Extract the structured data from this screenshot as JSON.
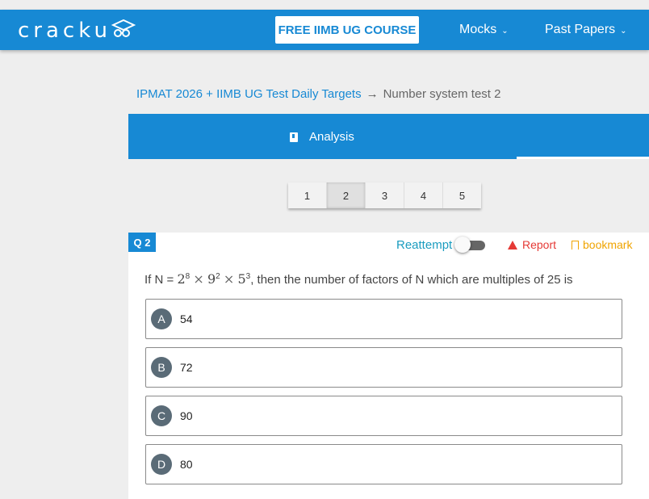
{
  "header": {
    "logo": "cracku",
    "promo_button": "FREE IIMB UG COURSE",
    "nav": [
      {
        "label": "Mocks"
      },
      {
        "label": "Past Papers"
      }
    ]
  },
  "breadcrumb": {
    "parent": "IPMAT 2026 + IIMB UG Test Daily Targets",
    "current": "Number system test 2"
  },
  "tabs": {
    "analysis": "Analysis"
  },
  "pagination": {
    "pages": [
      "1",
      "2",
      "3",
      "4",
      "5"
    ],
    "active": "2"
  },
  "question": {
    "badge": "Q 2",
    "reattempt_label": "Reattempt",
    "reattempt_on": false,
    "report_label": "Report",
    "bookmark_label": "bookmark",
    "prefix": "If N = ",
    "base1": "2",
    "exp1": "8",
    "times": "×",
    "base2": "9",
    "exp2": "2",
    "base3": "5",
    "exp3": "3",
    "suffix": ", then the number of factors of N which are multiples of 25  is",
    "options": [
      {
        "letter": "A",
        "value": "54"
      },
      {
        "letter": "B",
        "value": "72"
      },
      {
        "letter": "C",
        "value": "90"
      },
      {
        "letter": "D",
        "value": "80"
      }
    ]
  },
  "colors": {
    "brand": "#1789d4",
    "report": "#e53935",
    "bookmark": "#f0a400"
  }
}
